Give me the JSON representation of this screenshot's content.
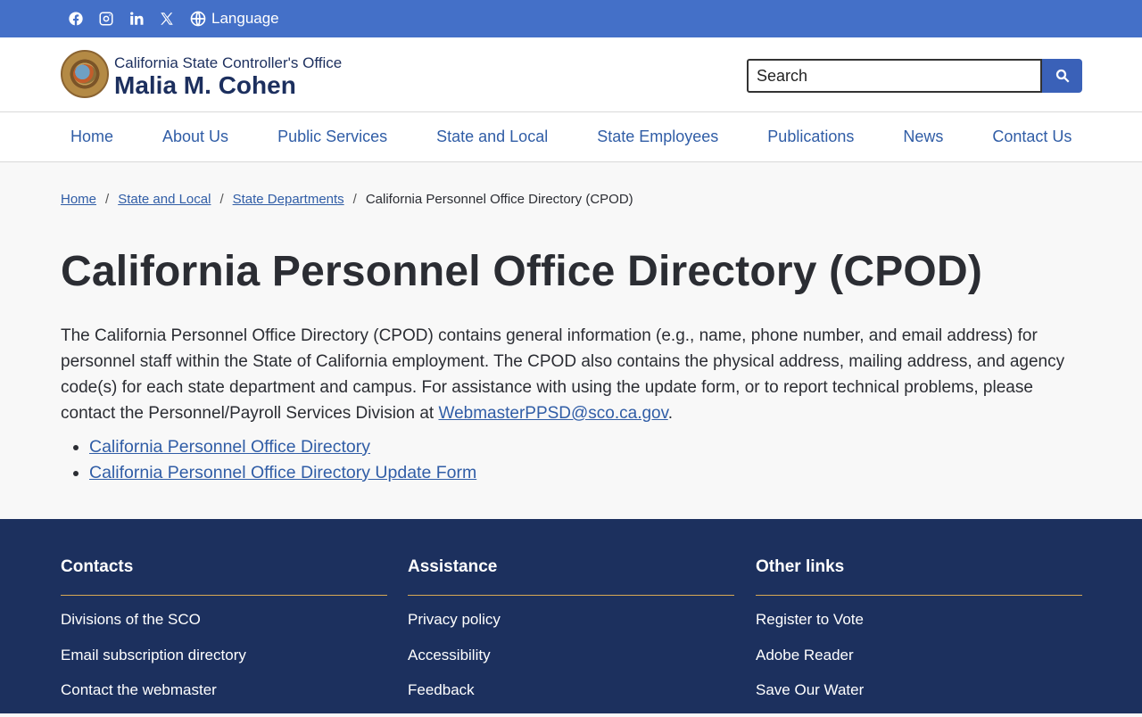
{
  "utility": {
    "social": [
      "facebook-icon",
      "instagram-icon",
      "linkedin-icon",
      "x-icon"
    ],
    "language_label": "Language"
  },
  "branding": {
    "org_sub": "California State Controller's Office",
    "org_name": "Malia M. Cohen",
    "search_placeholder": "Search"
  },
  "nav": {
    "items": [
      "Home",
      "About Us",
      "Public Services",
      "State and Local",
      "State Employees",
      "Publications",
      "News",
      "Contact Us"
    ]
  },
  "breadcrumb": {
    "items": [
      "Home",
      "State and Local",
      "State Departments"
    ],
    "current": "California Personnel Office Directory (CPOD)"
  },
  "main": {
    "title": "California Personnel Office Directory (CPOD)",
    "intro": "The California Personnel Office Directory (CPOD) contains general information (e.g., name, phone number, and email address) for personnel staff within the State of California employment. The CPOD also contains the physical address, mailing address, and agency code(s) for each state department and campus. For assistance with using the update form, or to report technical problems, please contact the Personnel/Payroll Services Division at",
    "email": "WebmasterPPSD@sco.ca.gov",
    "links": [
      "California Personnel Office Directory",
      "California Personnel Office Directory Update Form"
    ]
  },
  "footer": {
    "columns": [
      {
        "heading": "Contacts",
        "items": [
          "Divisions of the SCO",
          "Email subscription directory",
          "Contact the webmaster"
        ]
      },
      {
        "heading": "Assistance",
        "items": [
          "Privacy policy",
          "Accessibility",
          "Feedback"
        ]
      },
      {
        "heading": "Other links",
        "items": [
          "Register to Vote",
          "Adobe Reader",
          "Save Our Water"
        ]
      }
    ]
  },
  "colors": {
    "utility_bar": "#4470c8",
    "link": "#305da6",
    "footer_bg": "#1c305e",
    "footer_rule": "#d8a854"
  }
}
